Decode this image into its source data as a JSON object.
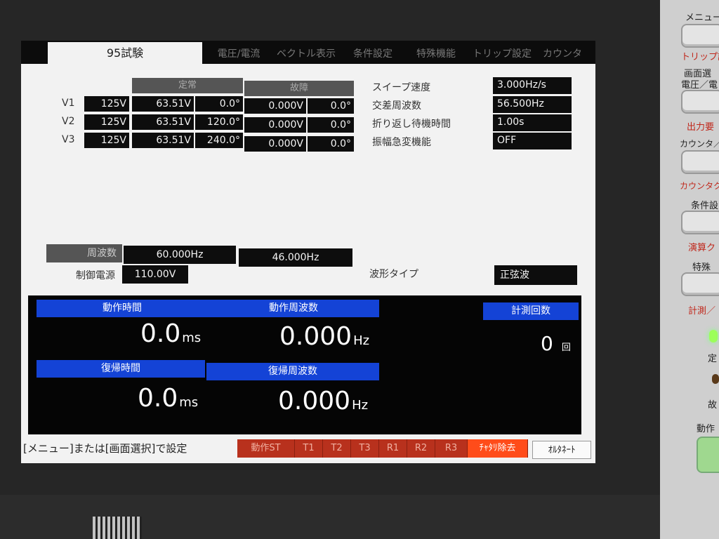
{
  "tabs": [
    {
      "label": "95試験",
      "active": true
    },
    {
      "label": "電圧/電流",
      "active": false
    },
    {
      "label": "ベクトル表示",
      "active": false
    },
    {
      "label": "条件設定",
      "active": false
    },
    {
      "label": "特殊機能",
      "active": false
    },
    {
      "label": "トリップ設定",
      "active": false
    },
    {
      "label": "カウンタ",
      "active": false
    }
  ],
  "voltage_table": {
    "header_normal": "定常",
    "header_fault": "故障",
    "rows": [
      {
        "name": "V1",
        "range": "125V",
        "normal_v": "63.51V",
        "normal_deg": "0.0°",
        "fault_v": "0.000V",
        "fault_deg": "0.0°"
      },
      {
        "name": "V2",
        "range": "125V",
        "normal_v": "63.51V",
        "normal_deg": "120.0°",
        "fault_v": "0.000V",
        "fault_deg": "0.0°"
      },
      {
        "name": "V3",
        "range": "125V",
        "normal_v": "63.51V",
        "normal_deg": "240.0°",
        "fault_v": "0.000V",
        "fault_deg": "0.0°"
      }
    ]
  },
  "settings": {
    "sweep_speed_label": "スイープ速度",
    "sweep_speed": "3.000Hz/s",
    "cross_freq_label": "交差周波数",
    "cross_freq": "56.500Hz",
    "return_wait_label": "折り返し待機時間",
    "return_wait": "1.00s",
    "amp_change_label": "振幅急変機能",
    "amp_change": "OFF"
  },
  "frequency": {
    "label": "周波数",
    "value1": "60.000Hz",
    "value2": "46.000Hz"
  },
  "control_power": {
    "label": "制御電源",
    "value": "110.00V"
  },
  "waveform": {
    "label": "波形タイプ",
    "value": "正弦波"
  },
  "results": {
    "op_time_label": "動作時間",
    "op_time_value": "0.0",
    "op_time_unit": "ms",
    "op_freq_label": "動作周波数",
    "op_freq_value": "0.000",
    "op_freq_unit": "Hz",
    "rec_time_label": "復帰時間",
    "rec_time_value": "0.0",
    "rec_time_unit": "ms",
    "rec_freq_label": "復帰周波数",
    "rec_freq_value": "0.000",
    "rec_freq_unit": "Hz",
    "count_label": "計測回数",
    "count_value": "0",
    "count_unit": "回"
  },
  "status_bar": {
    "hint": "[メニュー]または[画面選択]で設定",
    "buttons": [
      "動作ST",
      "T1",
      "T2",
      "T3",
      "R1",
      "R2",
      "R3",
      "ﾁｬﾀﾘ除去",
      "ｵﾙﾀﾈｰﾄ"
    ]
  },
  "side_panel": {
    "labels": [
      "メニュー",
      "トリップ設",
      "画面選",
      "電圧／電",
      "出力要",
      "カウンタ／",
      "カウンタク",
      "条件設",
      "演算ク",
      "特殊",
      "計測／",
      "定",
      "故",
      "動作"
    ]
  },
  "colors": {
    "accent_blue": "#1443d6",
    "status_red": "#b8311d",
    "status_highlight": "#ff4c1a"
  }
}
